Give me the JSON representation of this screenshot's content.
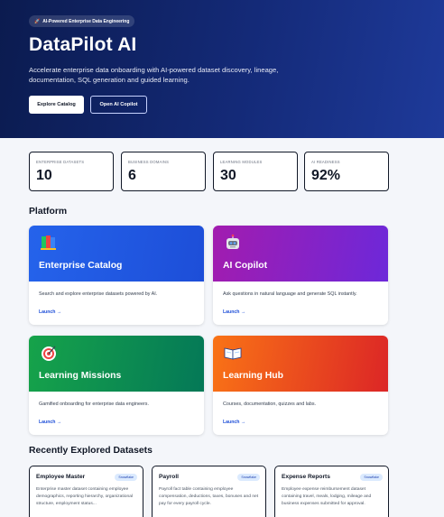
{
  "hero": {
    "badge": "AI-Powered Enterprise Data Engineering",
    "title": "DataPilot AI",
    "subtitle": "Accelerate enterprise data onboarding with AI-powered dataset discovery, lineage, documentation, SQL generation and guided learning.",
    "primary_button": "Explore Catalog",
    "secondary_button": "Open AI Copilot"
  },
  "stats": [
    {
      "label": "ENTERPRISE DATASETS",
      "value": "10"
    },
    {
      "label": "BUSINESS DOMAINS",
      "value": "6"
    },
    {
      "label": "LEARNING MODULES",
      "value": "30"
    },
    {
      "label": "AI READINESS",
      "value": "92%"
    }
  ],
  "platform": {
    "title": "Platform",
    "cards": [
      {
        "icon": "books-icon",
        "title": "Enterprise Catalog",
        "description": "Search and explore enterprise datasets powered by AI.",
        "link": "Launch →",
        "color_from": "#2563eb",
        "color_to": "#1d4ed8"
      },
      {
        "icon": "robot-icon",
        "title": "AI Copilot",
        "description": "Ask questions in natural language and generate SQL instantly.",
        "link": "Launch →",
        "color_from": "#a21caf",
        "color_to": "#6d28d9"
      },
      {
        "icon": "target-icon",
        "title": "Learning Missions",
        "description": "Gamified onboarding for enterprise data engineers.",
        "link": "Launch →",
        "color_from": "#16a34a",
        "color_to": "#047857"
      },
      {
        "icon": "book-icon",
        "title": "Learning Hub",
        "description": "Courses, documentation, quizzes and labs.",
        "link": "Launch →",
        "color_from": "#f97316",
        "color_to": "#dc2626"
      }
    ]
  },
  "recent": {
    "title": "Recently Explored Datasets",
    "datasets": [
      {
        "name": "Employee Master",
        "tag": "Snowflake",
        "description": "Enterprise master dataset containing employee demographics, reporting hierarchy, organizational structure, employment status..."
      },
      {
        "name": "Payroll",
        "tag": "Snowflake",
        "description": "Payroll fact table containing employee compensation, deductions, taxes, bonuses and net pay for every payroll cycle."
      },
      {
        "name": "Expense Reports",
        "tag": "Snowflake",
        "description": "Employee expense reimbursement dataset containing travel, meals, lodging, mileage and business expenses submitted for approval."
      }
    ]
  }
}
